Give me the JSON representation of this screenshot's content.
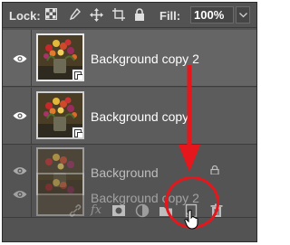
{
  "lockbar": {
    "lock_label": "Lock:",
    "fill_label": "Fill:",
    "fill_value": "100%",
    "lock_icons": [
      "lock-transparent-pixels-icon",
      "lock-image-pixels-icon",
      "lock-position-icon",
      "lock-artboard-icon",
      "lock-all-icon"
    ]
  },
  "layers": [
    {
      "name": "Background copy 2",
      "visible": true,
      "selected": true,
      "smart_object": true
    },
    {
      "name": "Background copy",
      "visible": true,
      "selected": false,
      "smart_object": true
    },
    {
      "name": "Background",
      "visible": true,
      "selected": false,
      "locked": true
    }
  ],
  "dragged_layer": {
    "name": "Background copy 2"
  },
  "toolbar": {
    "fx_label": "fx",
    "icons": [
      "link-layers-icon",
      "add-layer-style-icon",
      "add-mask-icon",
      "adjustment-layer-icon",
      "new-group-icon",
      "new-layer-icon",
      "delete-layer-icon"
    ]
  },
  "colors": {
    "panel_bg": "#535353",
    "annotation_red": "#e6161d"
  }
}
